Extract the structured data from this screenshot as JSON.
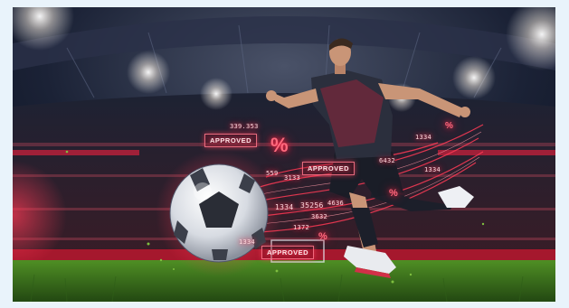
{
  "overlay": {
    "approved_labels": [
      "APPROVED",
      "APPROVED",
      "APPROVED"
    ],
    "percent_symbol": "%",
    "number_fragments": [
      "339.353",
      "559",
      "3133",
      "1334",
      "35256",
      "4636",
      "3632",
      "1372",
      "1334",
      "1334",
      "6432",
      "1334"
    ]
  },
  "colors": {
    "accent_red": "#ff2d4b",
    "jersey": "#2b2f3d",
    "grass": "#3f7a1f",
    "page_background": "#e9f3fb"
  }
}
